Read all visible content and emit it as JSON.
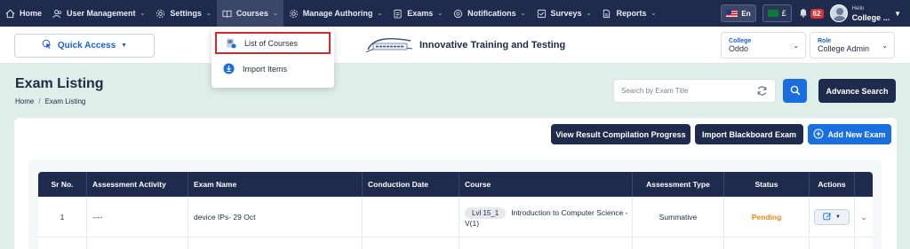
{
  "nav": {
    "items": [
      {
        "label": "Home",
        "icon": "home-icon",
        "chevron": false
      },
      {
        "label": "User Management",
        "icon": "users-icon",
        "chevron": true
      },
      {
        "label": "Settings",
        "icon": "gear-icon",
        "chevron": true
      },
      {
        "label": "Courses",
        "icon": "book-icon",
        "chevron": true,
        "active": true
      },
      {
        "label": "Manage Authoring",
        "icon": "gear-icon",
        "chevron": true
      },
      {
        "label": "Exams",
        "icon": "clipboard-icon",
        "chevron": true
      },
      {
        "label": "Notifications",
        "icon": "bell-icon",
        "chevron": true
      },
      {
        "label": "Surveys",
        "icon": "survey-icon",
        "chevron": true
      },
      {
        "label": "Reports",
        "icon": "report-icon",
        "chevron": true
      }
    ],
    "language": "En",
    "currency_symbol": "£",
    "notification_count": "62",
    "user_greeting": "Hello",
    "user_name": "College ..."
  },
  "subheader": {
    "quick_access": "Quick Access",
    "brand_name": "Innovative Training and Testing",
    "college_label": "College",
    "college_value": "Oddo",
    "role_label": "Role",
    "role_value": "College Admin"
  },
  "courses_menu": {
    "items": [
      {
        "label": "List of Courses"
      },
      {
        "label": "Import Items"
      }
    ]
  },
  "page": {
    "title": "Exam Listing",
    "breadcrumb_home": "Home",
    "breadcrumb_sep": "/",
    "breadcrumb_current": "Exam Listing",
    "search_placeholder": "Search by Exam Title",
    "advance_search": "Advance Search"
  },
  "actions": {
    "view_result": "View Result Compilation Progress",
    "import_blackboard": "Import Blackboard Exam",
    "add_new": "Add New Exam"
  },
  "table": {
    "headers": {
      "sr": "Sr No.",
      "activity": "Assessment Activity",
      "exam_name": "Exam Name",
      "date": "Conduction Date",
      "course": "Course",
      "type": "Assessment Type",
      "status": "Status",
      "actions": "Actions"
    },
    "rows": [
      {
        "sr": "1",
        "activity": "----",
        "exam_name": "device IPs- 29 Oct",
        "date": "",
        "course_code": "Lvl 15_1",
        "course_name": "Introduction to Computer Science -",
        "course_suffix": "V(1)",
        "type": "Summative",
        "status": "Pending"
      }
    ]
  },
  "colors": {
    "nav_bg": "#1f2b4d",
    "accent": "#1a6fe0",
    "pending": "#e8891a",
    "highlight": "#d7262b"
  }
}
